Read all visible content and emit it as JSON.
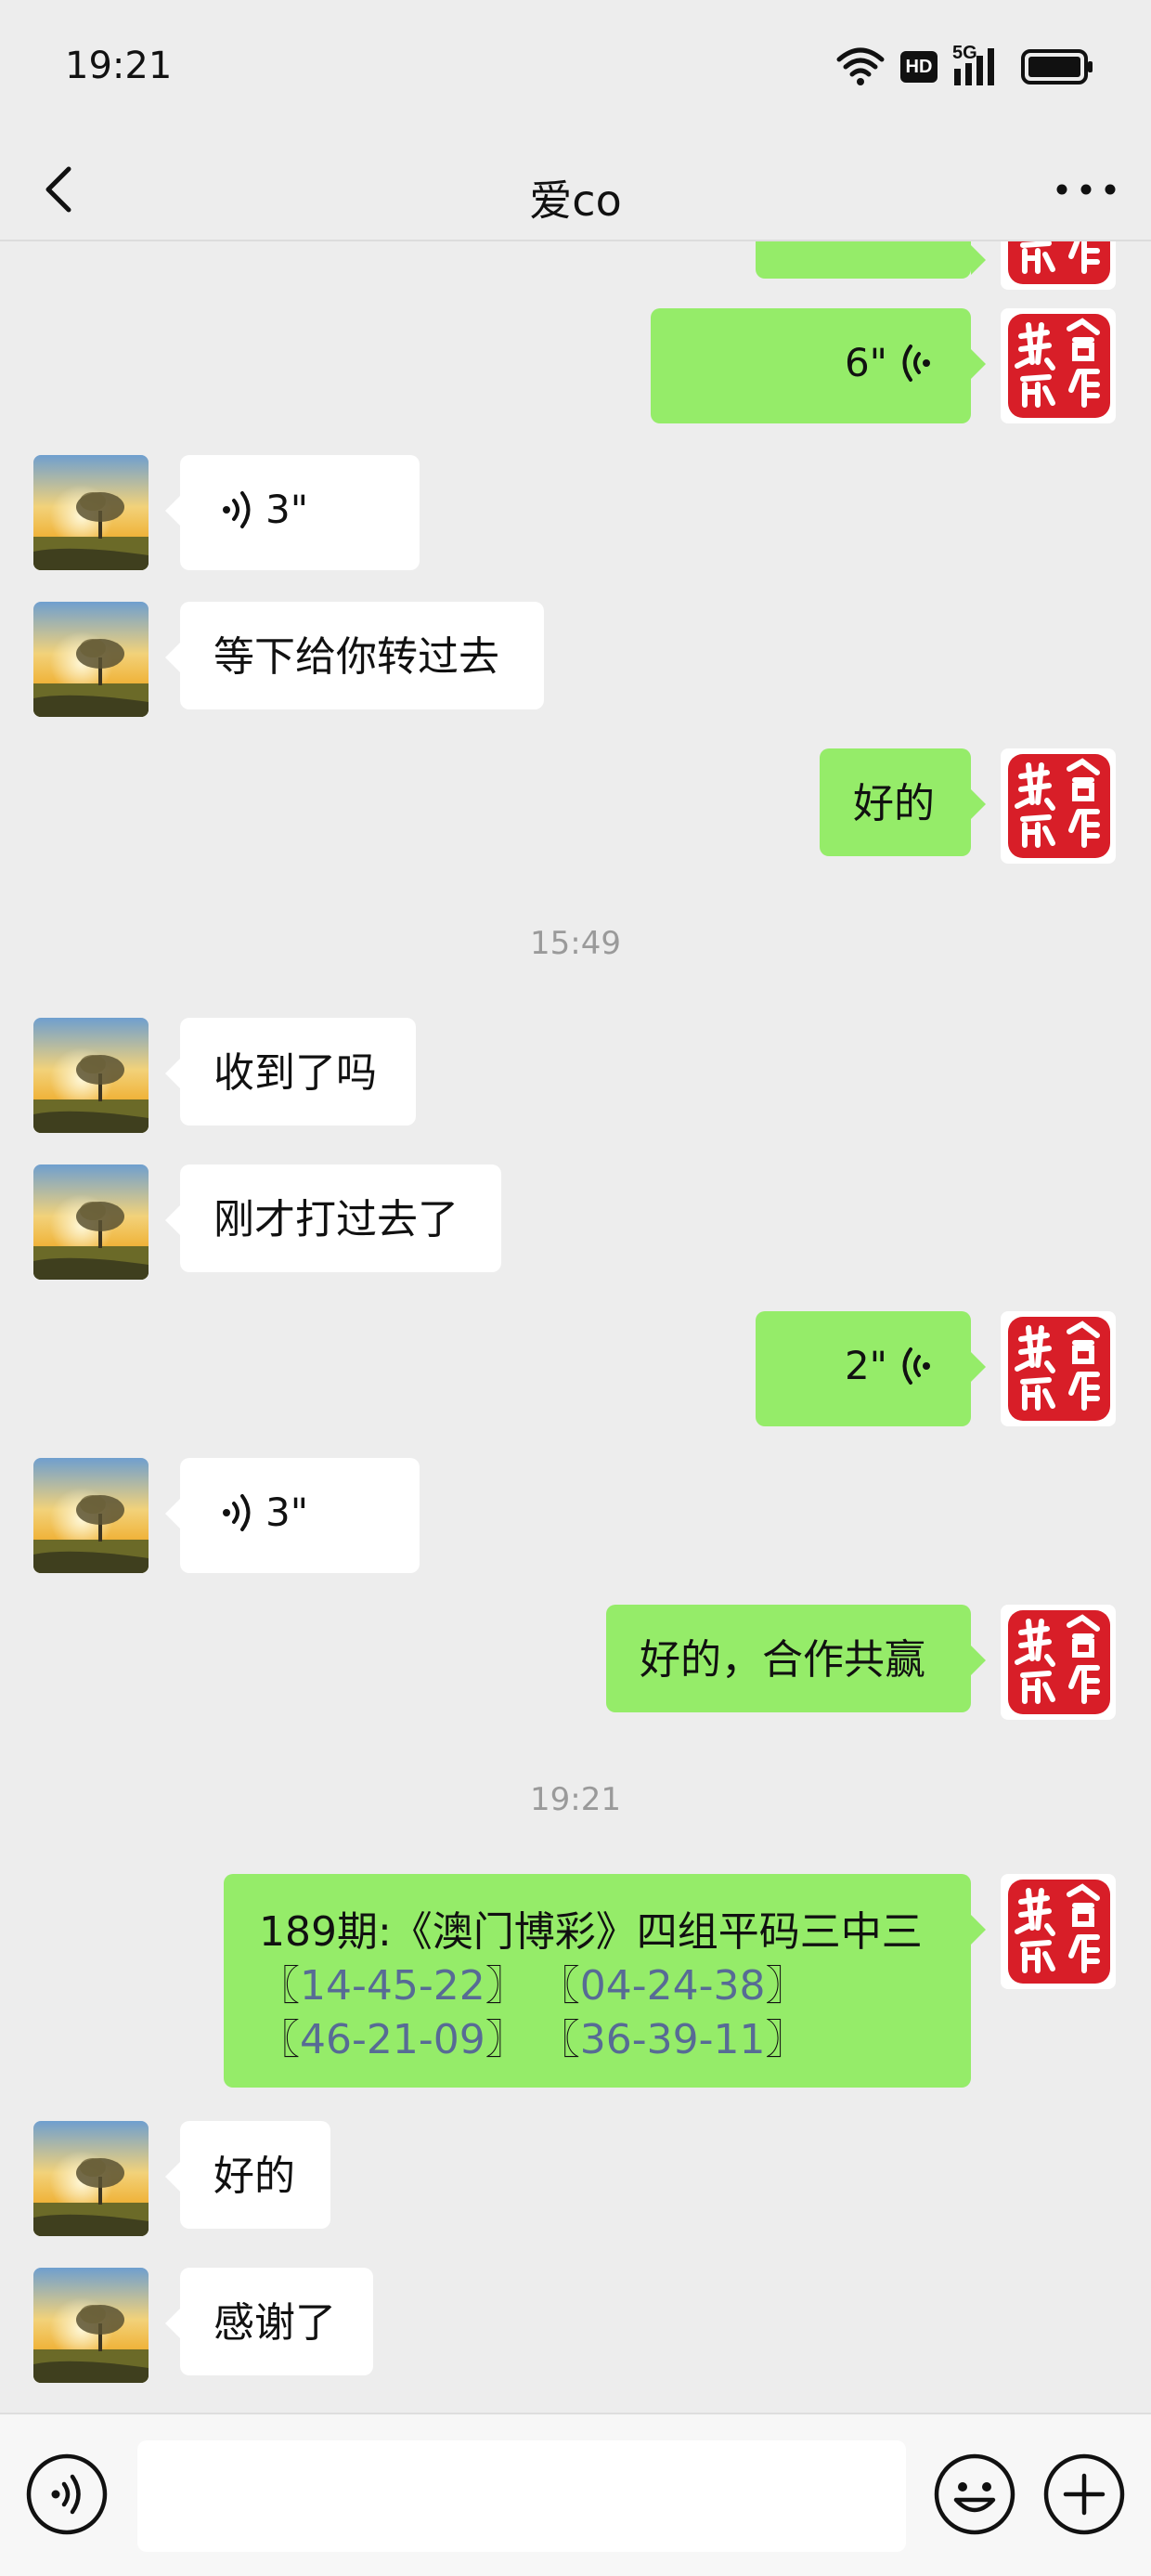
{
  "status": {
    "time": "19:21",
    "hd": "HD",
    "net": "5G"
  },
  "nav": {
    "title": "爱co"
  },
  "messages": {
    "m1": {
      "voice": "6\""
    },
    "m2": {
      "voice": "3\""
    },
    "m3": {
      "text": "等下给你转过去"
    },
    "m4": {
      "text": "好的"
    },
    "ts1": "15:49",
    "m5": {
      "text": "收到了吗"
    },
    "m6": {
      "text": "刚才打过去了"
    },
    "m7": {
      "voice": "2\""
    },
    "m8": {
      "voice": "3\""
    },
    "m9": {
      "text": "好的，合作共赢"
    },
    "ts2": "19:21",
    "m10": {
      "line1": "189期:《澳门博彩》四组平码三中三",
      "b1": "〖",
      "n1": "14-45-22",
      "e1": "〗",
      "b2": "〖",
      "n2": "04-24-38",
      "e2": "〗",
      "b3": "〖",
      "n3": "46-21-09",
      "e3": "〗",
      "b4": "〖",
      "n4": "36-39-11",
      "e4": "〗"
    },
    "m11": {
      "text": "好的"
    },
    "m12": {
      "text": "感谢了"
    }
  },
  "seal": {
    "text_a": "合作",
    "text_b": "共赢"
  },
  "icons": {
    "back": "chevron-left-icon",
    "more": "more-dots-icon",
    "voice": "voice-icon",
    "emoji": "emoji-icon",
    "plus": "plus-icon",
    "wifi": "wifi-icon",
    "signal": "signal-icon",
    "battery": "battery-icon"
  },
  "colors": {
    "outgoing": "#95ec69",
    "incoming": "#ffffff",
    "background": "#ededed",
    "link": "#576b95"
  }
}
